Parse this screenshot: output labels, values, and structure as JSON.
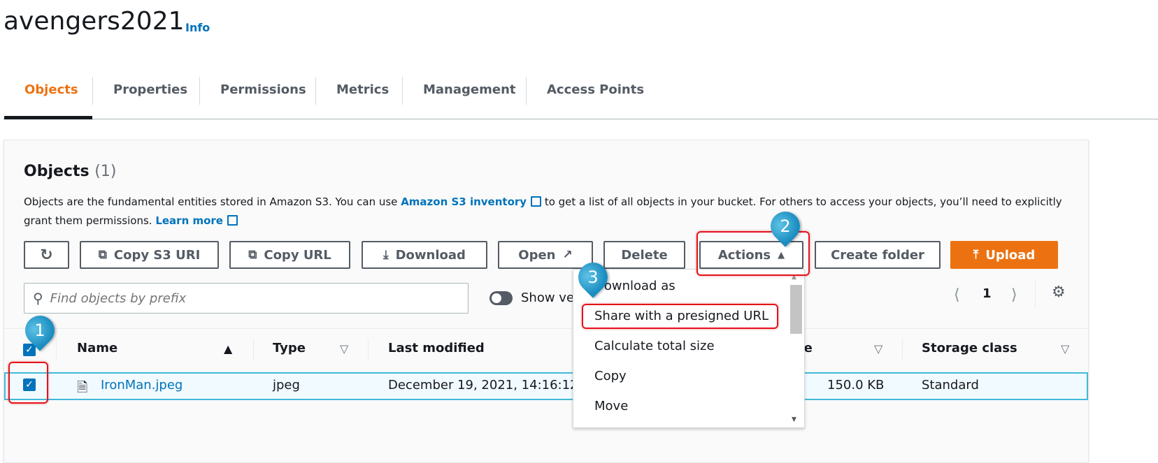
{
  "header": {
    "title": "avengers2021",
    "info": "Info"
  },
  "tabs": [
    {
      "label": "Objects",
      "active": true
    },
    {
      "label": "Properties"
    },
    {
      "label": "Permissions"
    },
    {
      "label": "Metrics"
    },
    {
      "label": "Management"
    },
    {
      "label": "Access Points"
    }
  ],
  "objects": {
    "heading": "Objects",
    "count": "(1)",
    "desc1_a": "Objects are the fundamental entities stored in Amazon S3. You can use ",
    "desc1_link": "Amazon S3 inventory",
    "desc1_b": " to get a list of all objects in your bucket. For others to access your objects, you’ll need to explicitly",
    "desc2_a": "grant them permissions. ",
    "desc2_link": "Learn more"
  },
  "toolbar": {
    "copy_s3_uri": "Copy S3 URI",
    "copy_url": "Copy URL",
    "download": "Download",
    "open": "Open",
    "delete": "Delete",
    "actions": "Actions",
    "create_folder": "Create folder",
    "upload": "Upload"
  },
  "search": {
    "placeholder": "Find objects by prefix"
  },
  "show_versions": "Show versions",
  "pagination": {
    "page": "1"
  },
  "table": {
    "columns": [
      "Name",
      "Type",
      "Last modified",
      "Size",
      "Storage class"
    ],
    "rows": [
      {
        "name": "IronMan.jpeg",
        "type": "jpeg",
        "last_modified": "December 19, 2021, 14:16:12",
        "size": "150.0 KB",
        "storage_class": "Standard",
        "selected": true
      }
    ]
  },
  "actions_menu": {
    "items": [
      "Download as",
      "Share with a presigned URL",
      "Calculate total size",
      "Copy",
      "Move"
    ]
  },
  "markers": [
    "1",
    "2",
    "3"
  ],
  "colors": {
    "accent": "#ec7211",
    "link": "#0073bb",
    "highlight": "#e3131b"
  }
}
